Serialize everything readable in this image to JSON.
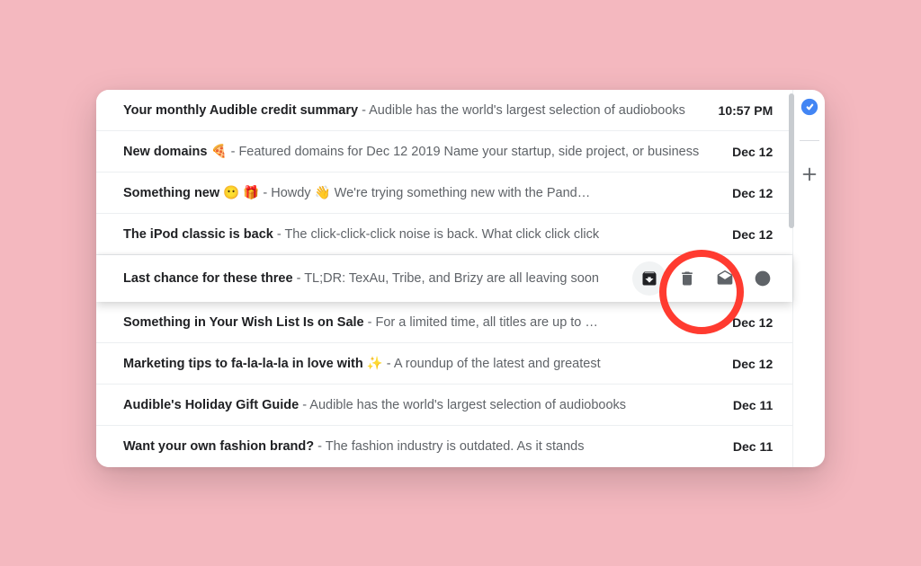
{
  "emails": [
    {
      "subject": "Your monthly Audible credit summary",
      "subject_emoji": "",
      "snippet": " - Audible has the world's largest selection of audiobooks",
      "date": "10:57 PM"
    },
    {
      "subject": "New domains",
      "subject_emoji": " 🍕 ",
      "snippet": " - Featured domains for Dec 12 2019 Name your startup, side project, or business",
      "date": "Dec 12"
    },
    {
      "subject": "Something new",
      "subject_emoji": " 😶 🎁 ",
      "snippet": " - Howdy 👋  We're trying something new with the Pand…",
      "date": "Dec 12"
    },
    {
      "subject": "The iPod classic is back",
      "subject_emoji": "",
      "snippet": " - The click-click-click noise is back. What click click click",
      "date": "Dec 12"
    },
    {
      "subject": "Last chance for these three",
      "subject_emoji": "",
      "snippet": " - TL;DR: TexAu, Tribe, and Brizy are all leaving soon",
      "date": ""
    },
    {
      "subject": "Something in Your Wish List Is on Sale",
      "subject_emoji": "",
      "snippet": " - For a limited time, all titles are up to …",
      "date": "Dec 12"
    },
    {
      "subject": "Marketing tips to fa-la-la-la in love with",
      "subject_emoji": " ✨ ",
      "snippet": " - A roundup of the latest and greatest",
      "date": "Dec 12"
    },
    {
      "subject": "Audible's Holiday Gift Guide",
      "subject_emoji": "",
      "snippet": " - Audible has the world's largest selection of audiobooks",
      "date": "Dec 11"
    },
    {
      "subject": "Want your own fashion brand?",
      "subject_emoji": "",
      "snippet": " - The fashion industry is outdated. As it stands",
      "date": "Dec 11"
    }
  ],
  "actions": {
    "archive": "Archive",
    "delete": "Delete",
    "mark_read": "Mark as read",
    "snooze": "Snooze"
  },
  "sidepanel": {
    "tasks": "Tasks",
    "add": "Get Add-ons"
  },
  "annotation": {
    "highlight": "archive-button"
  }
}
